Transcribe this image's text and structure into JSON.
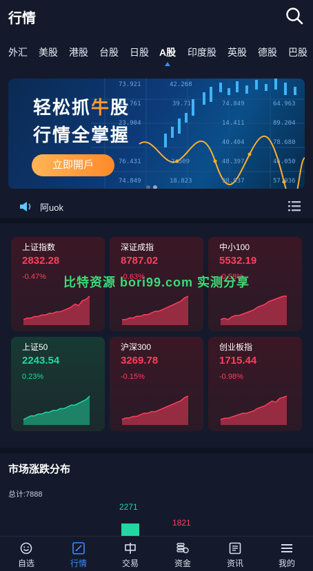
{
  "header": {
    "title": "行情",
    "search_icon": "search-icon"
  },
  "tabs": [
    {
      "label": "外汇"
    },
    {
      "label": "美股"
    },
    {
      "label": "港股"
    },
    {
      "label": "台股"
    },
    {
      "label": "日股"
    },
    {
      "label": "A股"
    },
    {
      "label": "印度股"
    },
    {
      "label": "英股"
    },
    {
      "label": "德股"
    },
    {
      "label": "巴股"
    }
  ],
  "active_tab": "A股",
  "banner": {
    "line1_prefix": "轻松抓",
    "line1_highlight": "牛",
    "line1_suffix": "股",
    "line2": "行情全掌握",
    "cta": "立即開戶",
    "grid_numbers": [
      "73.921",
      "42.268",
      "39.711",
      "88.761",
      "74.849",
      "64.963",
      "14.411",
      "89.204",
      "23.904",
      "40.404",
      "78.680",
      "76.431",
      "2.509",
      "48.397",
      "46.050",
      "74.849",
      "18.823",
      "98.937",
      "57.936"
    ]
  },
  "notice": {
    "text": "阿uok"
  },
  "indices": [
    {
      "name": "上证指数",
      "price": "2832.28",
      "change": "-0.47%",
      "trend": "down",
      "spark": [
        2,
        3,
        3,
        4,
        4,
        5,
        5,
        6,
        6,
        7,
        7,
        8,
        9,
        10,
        12,
        11,
        14,
        15,
        17
      ]
    },
    {
      "name": "深证成指",
      "price": "8787.02",
      "change": "-0.63%",
      "trend": "down",
      "spark": [
        2,
        2,
        3,
        3,
        4,
        4,
        5,
        5,
        6,
        7,
        7,
        8,
        9,
        10,
        11,
        12,
        13,
        15,
        16
      ]
    },
    {
      "name": "中小100",
      "price": "5532.19",
      "change": "-0.58%",
      "trend": "down",
      "spark": [
        3,
        4,
        3,
        5,
        6,
        6,
        7,
        8,
        9,
        10,
        12,
        13,
        14,
        16,
        17,
        18,
        19,
        20,
        20
      ]
    },
    {
      "name": "上证50",
      "price": "2243.54",
      "change": "0.23%",
      "trend": "up",
      "spark": [
        4,
        5,
        6,
        6,
        7,
        7,
        8,
        8,
        9,
        9,
        10,
        10,
        11,
        12,
        12,
        13,
        14,
        15,
        17
      ]
    },
    {
      "name": "沪深300",
      "price": "3269.78",
      "change": "-0.15%",
      "trend": "down",
      "spark": [
        2,
        3,
        3,
        4,
        4,
        5,
        6,
        6,
        7,
        7,
        8,
        9,
        10,
        11,
        12,
        13,
        14,
        16,
        17
      ]
    },
    {
      "name": "创业板指",
      "price": "1715.44",
      "change": "-0.98%",
      "trend": "down",
      "spark": [
        3,
        4,
        4,
        5,
        6,
        7,
        8,
        8,
        9,
        10,
        12,
        13,
        14,
        16,
        18,
        17,
        20,
        21,
        22
      ]
    }
  ],
  "watermark": "比特资源  bori99.com  实测分享",
  "distribution": {
    "title": "市场涨跌分布",
    "total": "总计:7888",
    "bars": [
      {
        "value": "2271",
        "color": "#22d7a0"
      },
      {
        "value": "1821",
        "color": "#ff3e5e"
      }
    ]
  },
  "bottom_nav": [
    {
      "label": "自选",
      "icon": "smile-icon"
    },
    {
      "label": "行情",
      "icon": "chart-icon"
    },
    {
      "label": "交易",
      "icon": "trade-icon"
    },
    {
      "label": "资金",
      "icon": "coins-icon"
    },
    {
      "label": "资讯",
      "icon": "news-icon"
    },
    {
      "label": "我的",
      "icon": "menu-icon"
    }
  ],
  "colors": {
    "accent": "#3d8bff",
    "down": "#ff3e5e",
    "up": "#22d7a0",
    "background": "#141a2b"
  }
}
